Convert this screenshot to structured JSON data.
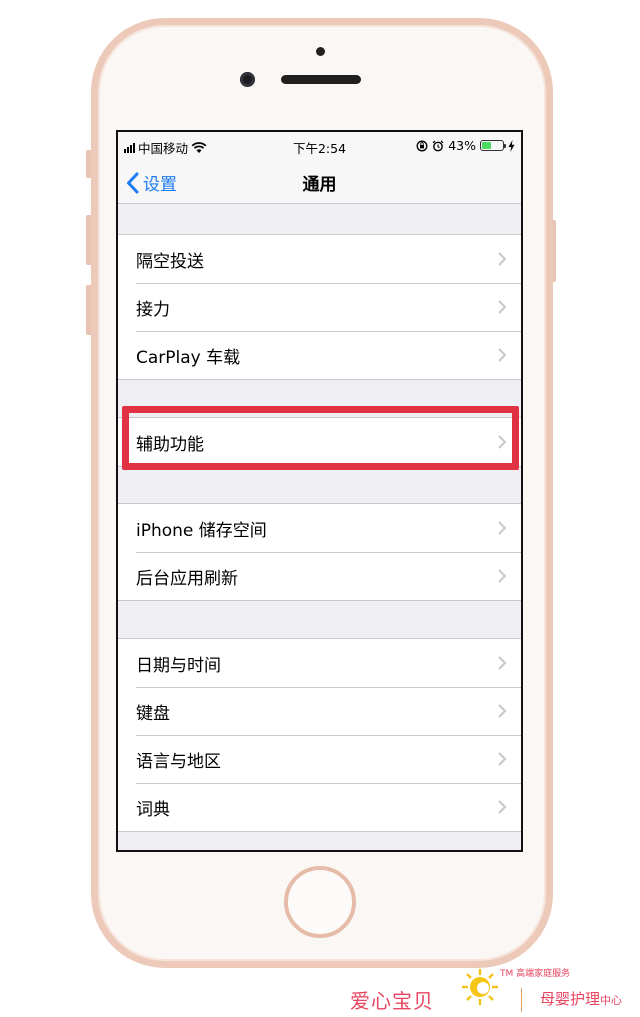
{
  "status_bar": {
    "carrier": "中国移动",
    "time": "下午2:54",
    "battery_percent": "43%",
    "battery_level": 0.43,
    "battery_color": "#4cd964"
  },
  "nav": {
    "back_label": "设置",
    "title": "通用",
    "accent_color": "#1c7cf4"
  },
  "groups": [
    {
      "items": [
        {
          "label": "隔空投送"
        },
        {
          "label": "接力"
        },
        {
          "label": "CarPlay 车载"
        }
      ]
    },
    {
      "items": [
        {
          "label": "辅助功能"
        }
      ]
    },
    {
      "items": [
        {
          "label": "iPhone 储存空间"
        },
        {
          "label": "后台应用刷新"
        }
      ]
    },
    {
      "items": [
        {
          "label": "日期与时间"
        },
        {
          "label": "键盘"
        },
        {
          "label": "语言与地区"
        },
        {
          "label": "词典"
        }
      ]
    }
  ],
  "highlight": {
    "target": "辅助功能",
    "color": "#e03242"
  },
  "watermark": {
    "brand": "爱心宝贝",
    "tagline": "TM 高端家庭服务",
    "sub_main": "母婴护理",
    "sub_small": "中心"
  }
}
